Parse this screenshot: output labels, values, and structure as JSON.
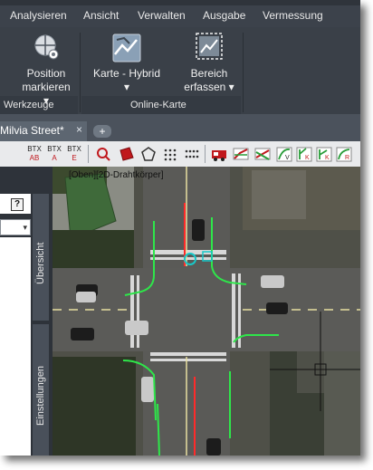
{
  "menu": {
    "items": [
      "Analysieren",
      "Ansicht",
      "Verwalten",
      "Ausgabe",
      "Vermessung"
    ]
  },
  "ribbon": {
    "position_button": {
      "line1": "Position",
      "line2": "markieren",
      "arrow": "▾"
    },
    "map_button": {
      "line1": "Karte - Hybrid",
      "arrow": "▾"
    },
    "capture_button": {
      "line1": "Bereich",
      "line2": "erfassen",
      "arrow": "▾"
    },
    "panel_tools_label": "Werkzeuge",
    "panel_online_map_label": "Online-Karte"
  },
  "document_tabs": {
    "active_tab": "Milvia Street*",
    "close": "×",
    "new_tab": "+"
  },
  "toolbar": {
    "btx": [
      "BTX",
      "BTX",
      "BTX"
    ],
    "btx_sub": [
      "AB",
      "A",
      "E"
    ]
  },
  "left_panel": {
    "help": "?",
    "combo_arrow": "▾",
    "tab_overview": "Übersicht",
    "tab_settings": "Einstellungen"
  },
  "viewport": {
    "label": "[Oben][2D-Drahtkörper]"
  },
  "colors": {
    "ribbon_bg": "#3a4048",
    "menu_bg": "#3c424b",
    "curb_green": "#2ee64a",
    "text_light": "#e8e8e8"
  }
}
